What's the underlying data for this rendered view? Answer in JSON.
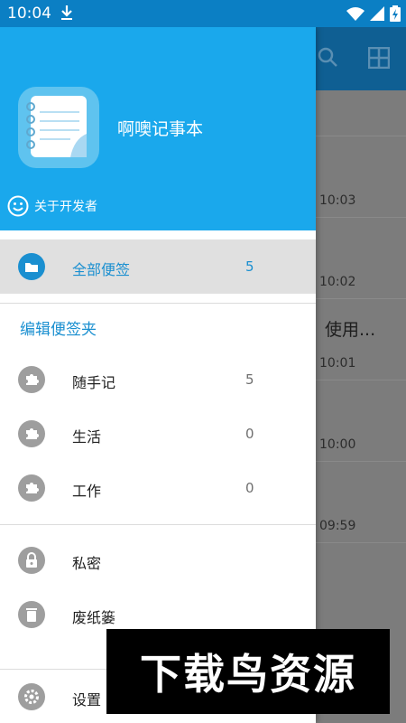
{
  "status_bar": {
    "time": "10:04"
  },
  "header": {
    "app_name": "啊噢记事本",
    "about_label": "关于开发者"
  },
  "all_notes": {
    "label": "全部便签",
    "count": "5"
  },
  "section": {
    "edit_folders": "编辑便签夹"
  },
  "folders": [
    {
      "label": "随手记",
      "count": "5"
    },
    {
      "label": "生活",
      "count": "0"
    },
    {
      "label": "工作",
      "count": "0"
    }
  ],
  "extras": {
    "private_label": "私密",
    "trash_label": "废纸篓",
    "settings_label": "设置"
  },
  "background_list": {
    "times": [
      "10:03",
      "10:02",
      "10:01",
      "10:00",
      "09:59"
    ],
    "snippet": "使用..."
  },
  "watermark": {
    "text": "下载鸟资源"
  },
  "colors": {
    "header_bg": "#1aa8ec",
    "accent": "#1a8fd0",
    "status_bar": "#0b7fc4"
  }
}
